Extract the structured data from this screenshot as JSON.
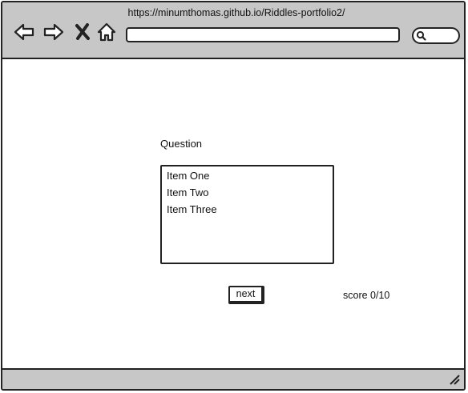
{
  "browser": {
    "url": "https://minumthomas.github.io/Riddles-portfolio2/",
    "address_value": "",
    "icons": {
      "back": "back-arrow-icon",
      "forward": "forward-arrow-icon",
      "stop": "close-icon",
      "home": "home-icon",
      "search": "search-icon",
      "resize": "resize-grip-icon"
    }
  },
  "quiz": {
    "question": "Question",
    "items": [
      "Item One",
      "Item Two",
      "Item Three"
    ],
    "next_label": "next",
    "score": "score 0/10"
  },
  "colors": {
    "chrome": "#c7c7c7",
    "stroke": "#222222",
    "page": "#ffffff"
  }
}
